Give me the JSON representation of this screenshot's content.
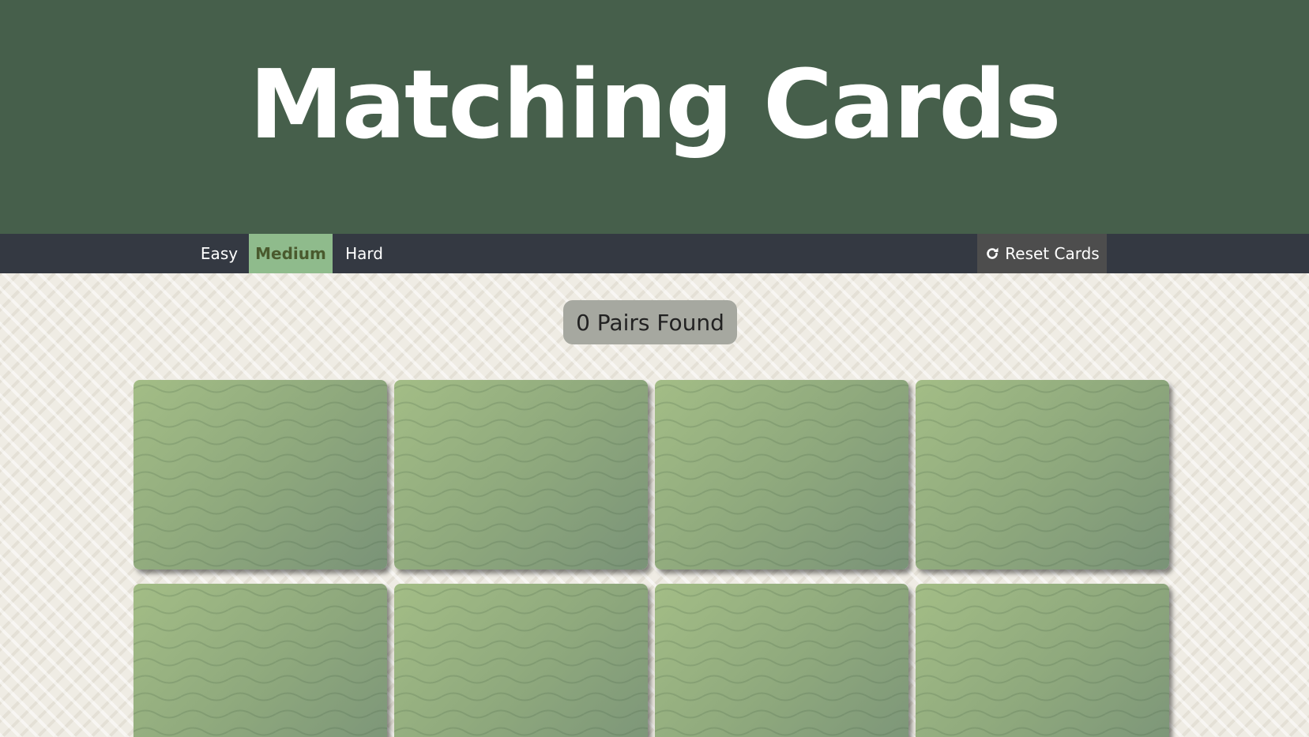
{
  "header": {
    "title": "Matching Cards"
  },
  "nav": {
    "difficulties": [
      {
        "label": "Easy"
      },
      {
        "label": "Medium"
      },
      {
        "label": "Hard"
      }
    ],
    "active_difficulty": "Medium",
    "reset_label": "Reset Cards",
    "reset_icon": "refresh-icon"
  },
  "status": {
    "pairs_text": "0 Pairs Found"
  },
  "cards": {
    "count_visible": 8,
    "face": "down",
    "pattern_icon": "wave-pattern"
  },
  "colors": {
    "header_bg": "#465f4b",
    "nav_bg": "#343942",
    "active_tab_bg": "#8fbb8c",
    "card_green": "#98b480"
  }
}
